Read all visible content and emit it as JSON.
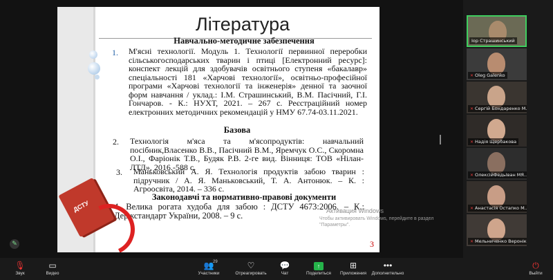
{
  "slide": {
    "title": "Література",
    "section1": "Навчально-методичне забезпечення",
    "item1_num": "1.",
    "item1": "М'ясні технології. Модуль 1. Технології первинної переробки сільськогосподарських тварин і птиці [Електронний ресурс]: конспект лекцій для здобувачів освітнього ступеня «бакалавр» спеціальності 181 «Харчові технології», освітньо-професійної програми «Харчові технології та інженерія» денної та заочної форм навчання / уклад.: І.М. Страшинський, В.М. Пасічний, Г.І. Гончаров. - К.: НУХТ, 2021. – 267 с. Реєстраційний номер електронних методичних рекомендацій у НМУ 67.74-03.11.2021.",
    "section2": "Базова",
    "item2_num": "2.",
    "item2": "Технологія м'яса та м'ясопродуктів: навчальний посібник,Власенко В.В., Пасічний В.М., Яремчук О.С., Скоромна О.І., Фаріонік Т.В., Будяк Р.В. 2-ге вид. Вінниця: ТОВ «Нілан-ЛТД», 2016.-588 с.",
    "item3_num": "3.",
    "item3": "Маньковський А. Я. Технологія продуктів забою тварин : підручник / А. Я. Маньковський, Т. А. Антонюк. – К. : Агроосвіта, 2014. – 336 с.",
    "section3": "Законодавчі та нормативно-правові документи",
    "item4": "4. Велика рогата худоба для забою : ДСТУ 4673:2006. – К.: Держстандарт України, 2008. – 9 с.",
    "page_number": "3",
    "book_label": "ДСТУ"
  },
  "watermark": {
    "line1": "Активация Windows",
    "line2": "Чтобы активировать Windows, перейдите в раздел \"Параметры\"."
  },
  "participants": [
    {
      "name": "Іор Страшинський",
      "muted": false,
      "active": true
    },
    {
      "name": "Oleg Galenko",
      "muted": true
    },
    {
      "name": "Сергій Бондаренко М...",
      "muted": true
    },
    {
      "name": "Надія Щербакова",
      "muted": true
    },
    {
      "name": "ОлексійФедьІван МЯ...",
      "muted": true
    },
    {
      "name": "Анастасія Остапко М...",
      "muted": true
    },
    {
      "name": "Мельниченко Веронік...",
      "muted": true
    }
  ],
  "toolbar": {
    "audio": "Звук",
    "video": "Видео",
    "participants": "Участники",
    "participants_count": "29",
    "react": "Отреагировать",
    "chat": "Чат",
    "share": "Поделиться",
    "apps": "Приложения",
    "more": "Дополнительно",
    "exit": "Выйти"
  },
  "colors": {
    "accent_green": "#25b34a",
    "exit_red": "#e33333",
    "slide_number_red": "#cc0000"
  }
}
